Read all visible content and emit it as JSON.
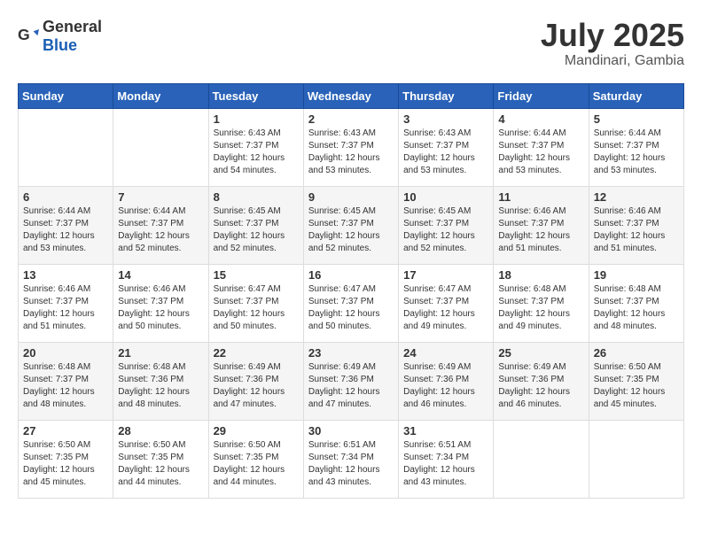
{
  "header": {
    "logo_general": "General",
    "logo_blue": "Blue",
    "month": "July 2025",
    "location": "Mandinari, Gambia"
  },
  "weekdays": [
    "Sunday",
    "Monday",
    "Tuesday",
    "Wednesday",
    "Thursday",
    "Friday",
    "Saturday"
  ],
  "weeks": [
    [
      {
        "day": "",
        "sunrise": "",
        "sunset": "",
        "daylight": ""
      },
      {
        "day": "",
        "sunrise": "",
        "sunset": "",
        "daylight": ""
      },
      {
        "day": "1",
        "sunrise": "Sunrise: 6:43 AM",
        "sunset": "Sunset: 7:37 PM",
        "daylight": "Daylight: 12 hours and 54 minutes."
      },
      {
        "day": "2",
        "sunrise": "Sunrise: 6:43 AM",
        "sunset": "Sunset: 7:37 PM",
        "daylight": "Daylight: 12 hours and 53 minutes."
      },
      {
        "day": "3",
        "sunrise": "Sunrise: 6:43 AM",
        "sunset": "Sunset: 7:37 PM",
        "daylight": "Daylight: 12 hours and 53 minutes."
      },
      {
        "day": "4",
        "sunrise": "Sunrise: 6:44 AM",
        "sunset": "Sunset: 7:37 PM",
        "daylight": "Daylight: 12 hours and 53 minutes."
      },
      {
        "day": "5",
        "sunrise": "Sunrise: 6:44 AM",
        "sunset": "Sunset: 7:37 PM",
        "daylight": "Daylight: 12 hours and 53 minutes."
      }
    ],
    [
      {
        "day": "6",
        "sunrise": "Sunrise: 6:44 AM",
        "sunset": "Sunset: 7:37 PM",
        "daylight": "Daylight: 12 hours and 53 minutes."
      },
      {
        "day": "7",
        "sunrise": "Sunrise: 6:44 AM",
        "sunset": "Sunset: 7:37 PM",
        "daylight": "Daylight: 12 hours and 52 minutes."
      },
      {
        "day": "8",
        "sunrise": "Sunrise: 6:45 AM",
        "sunset": "Sunset: 7:37 PM",
        "daylight": "Daylight: 12 hours and 52 minutes."
      },
      {
        "day": "9",
        "sunrise": "Sunrise: 6:45 AM",
        "sunset": "Sunset: 7:37 PM",
        "daylight": "Daylight: 12 hours and 52 minutes."
      },
      {
        "day": "10",
        "sunrise": "Sunrise: 6:45 AM",
        "sunset": "Sunset: 7:37 PM",
        "daylight": "Daylight: 12 hours and 52 minutes."
      },
      {
        "day": "11",
        "sunrise": "Sunrise: 6:46 AM",
        "sunset": "Sunset: 7:37 PM",
        "daylight": "Daylight: 12 hours and 51 minutes."
      },
      {
        "day": "12",
        "sunrise": "Sunrise: 6:46 AM",
        "sunset": "Sunset: 7:37 PM",
        "daylight": "Daylight: 12 hours and 51 minutes."
      }
    ],
    [
      {
        "day": "13",
        "sunrise": "Sunrise: 6:46 AM",
        "sunset": "Sunset: 7:37 PM",
        "daylight": "Daylight: 12 hours and 51 minutes."
      },
      {
        "day": "14",
        "sunrise": "Sunrise: 6:46 AM",
        "sunset": "Sunset: 7:37 PM",
        "daylight": "Daylight: 12 hours and 50 minutes."
      },
      {
        "day": "15",
        "sunrise": "Sunrise: 6:47 AM",
        "sunset": "Sunset: 7:37 PM",
        "daylight": "Daylight: 12 hours and 50 minutes."
      },
      {
        "day": "16",
        "sunrise": "Sunrise: 6:47 AM",
        "sunset": "Sunset: 7:37 PM",
        "daylight": "Daylight: 12 hours and 50 minutes."
      },
      {
        "day": "17",
        "sunrise": "Sunrise: 6:47 AM",
        "sunset": "Sunset: 7:37 PM",
        "daylight": "Daylight: 12 hours and 49 minutes."
      },
      {
        "day": "18",
        "sunrise": "Sunrise: 6:48 AM",
        "sunset": "Sunset: 7:37 PM",
        "daylight": "Daylight: 12 hours and 49 minutes."
      },
      {
        "day": "19",
        "sunrise": "Sunrise: 6:48 AM",
        "sunset": "Sunset: 7:37 PM",
        "daylight": "Daylight: 12 hours and 48 minutes."
      }
    ],
    [
      {
        "day": "20",
        "sunrise": "Sunrise: 6:48 AM",
        "sunset": "Sunset: 7:37 PM",
        "daylight": "Daylight: 12 hours and 48 minutes."
      },
      {
        "day": "21",
        "sunrise": "Sunrise: 6:48 AM",
        "sunset": "Sunset: 7:36 PM",
        "daylight": "Daylight: 12 hours and 48 minutes."
      },
      {
        "day": "22",
        "sunrise": "Sunrise: 6:49 AM",
        "sunset": "Sunset: 7:36 PM",
        "daylight": "Daylight: 12 hours and 47 minutes."
      },
      {
        "day": "23",
        "sunrise": "Sunrise: 6:49 AM",
        "sunset": "Sunset: 7:36 PM",
        "daylight": "Daylight: 12 hours and 47 minutes."
      },
      {
        "day": "24",
        "sunrise": "Sunrise: 6:49 AM",
        "sunset": "Sunset: 7:36 PM",
        "daylight": "Daylight: 12 hours and 46 minutes."
      },
      {
        "day": "25",
        "sunrise": "Sunrise: 6:49 AM",
        "sunset": "Sunset: 7:36 PM",
        "daylight": "Daylight: 12 hours and 46 minutes."
      },
      {
        "day": "26",
        "sunrise": "Sunrise: 6:50 AM",
        "sunset": "Sunset: 7:35 PM",
        "daylight": "Daylight: 12 hours and 45 minutes."
      }
    ],
    [
      {
        "day": "27",
        "sunrise": "Sunrise: 6:50 AM",
        "sunset": "Sunset: 7:35 PM",
        "daylight": "Daylight: 12 hours and 45 minutes."
      },
      {
        "day": "28",
        "sunrise": "Sunrise: 6:50 AM",
        "sunset": "Sunset: 7:35 PM",
        "daylight": "Daylight: 12 hours and 44 minutes."
      },
      {
        "day": "29",
        "sunrise": "Sunrise: 6:50 AM",
        "sunset": "Sunset: 7:35 PM",
        "daylight": "Daylight: 12 hours and 44 minutes."
      },
      {
        "day": "30",
        "sunrise": "Sunrise: 6:51 AM",
        "sunset": "Sunset: 7:34 PM",
        "daylight": "Daylight: 12 hours and 43 minutes."
      },
      {
        "day": "31",
        "sunrise": "Sunrise: 6:51 AM",
        "sunset": "Sunset: 7:34 PM",
        "daylight": "Daylight: 12 hours and 43 minutes."
      },
      {
        "day": "",
        "sunrise": "",
        "sunset": "",
        "daylight": ""
      },
      {
        "day": "",
        "sunrise": "",
        "sunset": "",
        "daylight": ""
      }
    ]
  ]
}
